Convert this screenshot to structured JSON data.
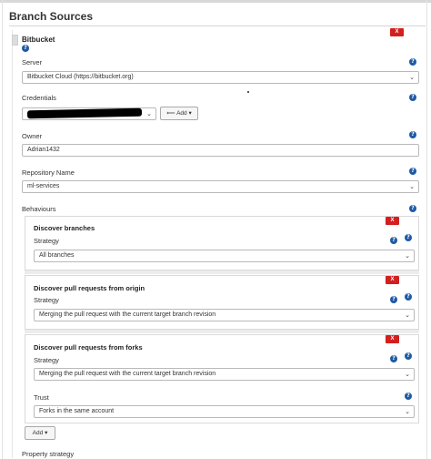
{
  "section": {
    "title": "Branch Sources"
  },
  "source": {
    "name": "Bitbucket",
    "delete_label": "X",
    "server": {
      "label": "Server",
      "value": "Bitbucket Cloud (https://bitbucket.org)"
    },
    "credentials": {
      "label": "Credentials",
      "add_label": "Add"
    },
    "owner": {
      "label": "Owner",
      "value": "Adrian1432"
    },
    "repository": {
      "label": "Repository Name",
      "value": "ml-services"
    },
    "behaviours": {
      "label": "Behaviours",
      "items": [
        {
          "title": "Discover branches",
          "strategy_label": "Strategy",
          "strategy_value": "All branches"
        },
        {
          "title": "Discover pull requests from origin",
          "strategy_label": "Strategy",
          "strategy_value": "Merging the pull request with the current target branch revision"
        },
        {
          "title": "Discover pull requests from forks",
          "strategy_label": "Strategy",
          "strategy_value": "Merging the pull request with the current target branch revision",
          "trust_label": "Trust",
          "trust_value": "Forks in the same account"
        }
      ],
      "add_label": "Add"
    },
    "property_strategy": {
      "label": "Property strategy"
    }
  },
  "icons": {
    "help": "?",
    "chevron": "⌄",
    "add_key": "⟸",
    "caret": "▾"
  },
  "colors": {
    "help_blue": "#1f5aa6",
    "delete_red": "#d21f1f"
  }
}
